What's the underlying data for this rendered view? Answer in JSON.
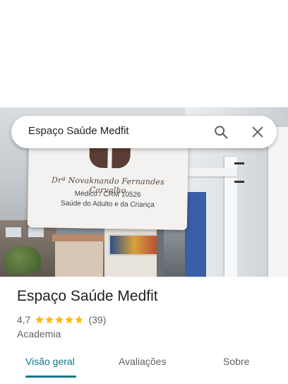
{
  "search": {
    "query": "Espaço Saúde Medfit"
  },
  "photo": {
    "sign_name": "Drª Novaknando Fernandes Carvalho",
    "sign_line1": "Médico / CRM 10526",
    "sign_line2": "Saúde do Adulto e da Criança"
  },
  "place": {
    "title": "Espaço Saúde Medfit",
    "rating": "4,7",
    "rating_value": 4.7,
    "review_count": "(39)",
    "category": "Academia"
  },
  "tabs": [
    {
      "label": "Visão geral",
      "active": true
    },
    {
      "label": "Avaliações",
      "active": false
    },
    {
      "label": "Sobre",
      "active": false
    }
  ],
  "colors": {
    "accent": "#0b7a8a",
    "star": "#fbbc04"
  }
}
